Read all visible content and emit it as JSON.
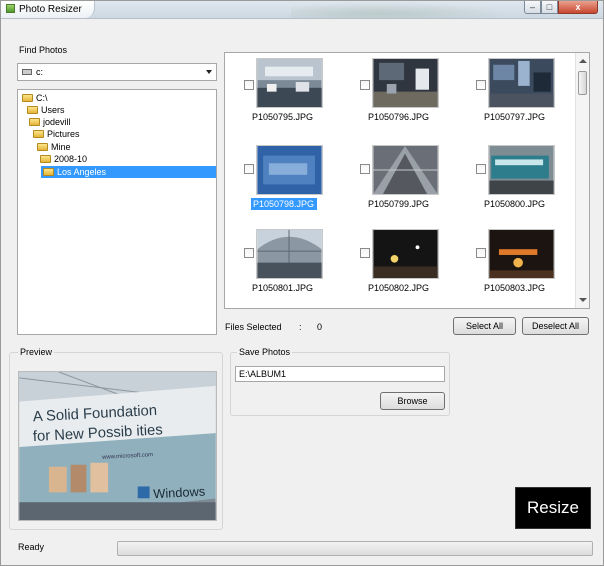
{
  "window": {
    "title": "Photo Resizer",
    "controls": {
      "minimize": "–",
      "maximize": "□",
      "close": "x"
    }
  },
  "find_photos": {
    "label": "Find Photos",
    "drive": "c:",
    "tree": [
      {
        "label": "C:\\",
        "depth": 0
      },
      {
        "label": "Users",
        "depth": 1
      },
      {
        "label": "jodevill",
        "depth": 2
      },
      {
        "label": "Pictures",
        "depth": 3
      },
      {
        "label": "Mine",
        "depth": 4
      },
      {
        "label": "2008-10",
        "depth": 5
      },
      {
        "label": "Los Angeles",
        "depth": 6,
        "selected": true
      }
    ]
  },
  "thumbnails": [
    {
      "file": "P1050795.JPG",
      "checked": false,
      "selected": false
    },
    {
      "file": "P1050796.JPG",
      "checked": false,
      "selected": false
    },
    {
      "file": "P1050797.JPG",
      "checked": false,
      "selected": false
    },
    {
      "file": "P1050798.JPG",
      "checked": false,
      "selected": true
    },
    {
      "file": "P1050799.JPG",
      "checked": false,
      "selected": false
    },
    {
      "file": "P1050800.JPG",
      "checked": false,
      "selected": false
    },
    {
      "file": "P1050801.JPG",
      "checked": false,
      "selected": false
    },
    {
      "file": "P1050802.JPG",
      "checked": false,
      "selected": false
    },
    {
      "file": "P1050803.JPG",
      "checked": false,
      "selected": false
    }
  ],
  "selection": {
    "label": "Files Selected",
    "separator": ":",
    "count": "0",
    "select_all": "Select All",
    "deselect_all": "Deselect All"
  },
  "preview": {
    "label": "Preview",
    "banner_line1": "A Solid Foundation",
    "banner_line2": "for New Possib ities",
    "banner_url": "www.microsoft.com",
    "banner_brand": "Windows"
  },
  "save_photos": {
    "label": "Save Photos",
    "path": "E:\\ALBUM1",
    "browse": "Browse"
  },
  "resize_button": "Resize",
  "status": {
    "text": "Ready",
    "progress": 0
  },
  "colors": {
    "selection": "#3399ff",
    "resize_bg": "#000000"
  }
}
